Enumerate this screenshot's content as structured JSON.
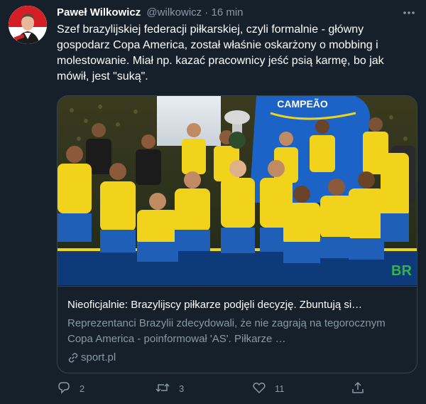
{
  "tweet": {
    "author_name": "Paweł Wilkowicz",
    "meta": "@wilkowicz · 16 min",
    "text": "Szef brazylijskiej federacji piłkarskiej, czyli formalnie - główny gospodarz Copa America, został właśnie oskarżony o mobbing i molestowanie. Miał np. kazać pracownicy jeść psią karmę, bo jak mówił, jest \"suką\"."
  },
  "card": {
    "title": "Nieoficjalnie: Brazylijscy piłkarze podjęli decyzję. Zbuntują si…",
    "description": "Reprezentanci Brazylii zdecydowali, że nie zagrają na tegorocznym Copa America - poinformował 'AS'. Piłkarze …",
    "domain": "sport.pl",
    "image_banner_text": "CAMPEÃO",
    "image_corner_text": "BR"
  },
  "actions": {
    "reply_count": "2",
    "retweet_count": "3",
    "like_count": "11"
  },
  "colors": {
    "background": "#15202b",
    "secondary_text": "#8899a6",
    "border": "#38444d",
    "jersey_yellow": "#f2d31b",
    "shorts_blue": "#1f5fb8",
    "banner_blue": "#1c63c7"
  },
  "icons": [
    "more-icon",
    "reply-icon",
    "retweet-icon",
    "like-icon",
    "share-icon",
    "link-icon"
  ]
}
